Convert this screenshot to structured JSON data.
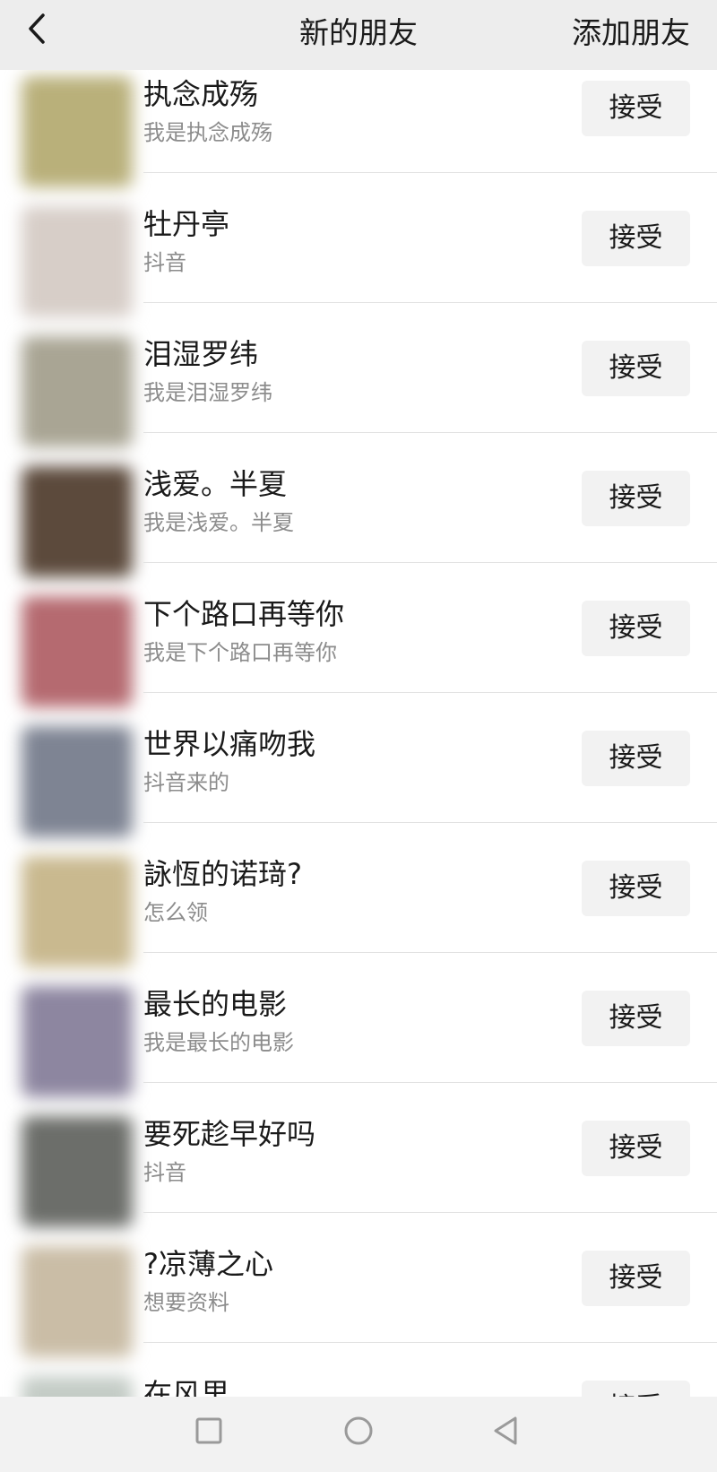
{
  "header": {
    "back_icon": "chevron-left-icon",
    "title": "新的朋友",
    "add_friend_label": "添加朋友"
  },
  "requests": [
    {
      "name": "执念成殇",
      "message": "我是执念成殇",
      "accept_label": "接受",
      "avatar_color": "#b9b07a"
    },
    {
      "name": "牡丹亭",
      "message": "抖音",
      "accept_label": "接受",
      "avatar_color": "#d7cec8"
    },
    {
      "name": "泪湿罗纬",
      "message": "我是泪湿罗纬",
      "accept_label": "接受",
      "avatar_color": "#a9a594"
    },
    {
      "name": "浅爱。半夏",
      "message": "我是浅爱。半夏",
      "accept_label": "接受",
      "avatar_color": "#5c4a3c"
    },
    {
      "name": "下个路口再等你",
      "message": "我是下个路口再等你",
      "accept_label": "接受",
      "avatar_color": "#b56a70"
    },
    {
      "name": "世界以痛吻我",
      "message": "抖音来的",
      "accept_label": "接受",
      "avatar_color": "#7e8493"
    },
    {
      "name": "詠恆的诺𤦺?",
      "message": "怎么领",
      "accept_label": "接受",
      "avatar_color": "#c9b98f"
    },
    {
      "name": "最长的电影",
      "message": "我是最长的电影",
      "accept_label": "接受",
      "avatar_color": "#8d86a0"
    },
    {
      "name": "要死趁早好吗",
      "message": "抖音",
      "accept_label": "接受",
      "avatar_color": "#6c6e6a"
    },
    {
      "name": "?凉薄之心",
      "message": "想要资料",
      "accept_label": "接受",
      "avatar_color": "#cabda6"
    },
    {
      "name": "在风里",
      "message": "",
      "accept_label": "接受",
      "avatar_color": "#c4ccc6"
    }
  ],
  "navbar": {
    "recents_icon": "square-icon",
    "home_icon": "circle-icon",
    "back_icon": "triangle-back-icon"
  }
}
